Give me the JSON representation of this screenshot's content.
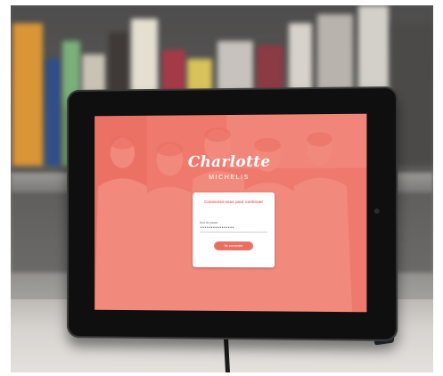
{
  "app": {
    "logo_text": "Charlotte",
    "logo_subtitle": "MICHELIS"
  },
  "login": {
    "title": "Connectez-vous pour continuer",
    "field_label": "Mot de passe",
    "password_value": "••••••••••••••••",
    "button_label": "Se connecter"
  },
  "colors": {
    "overlay": "#ef6c60",
    "accent": "#e96a5c",
    "bezel": "#0f0f10",
    "case": "#2c3440"
  }
}
